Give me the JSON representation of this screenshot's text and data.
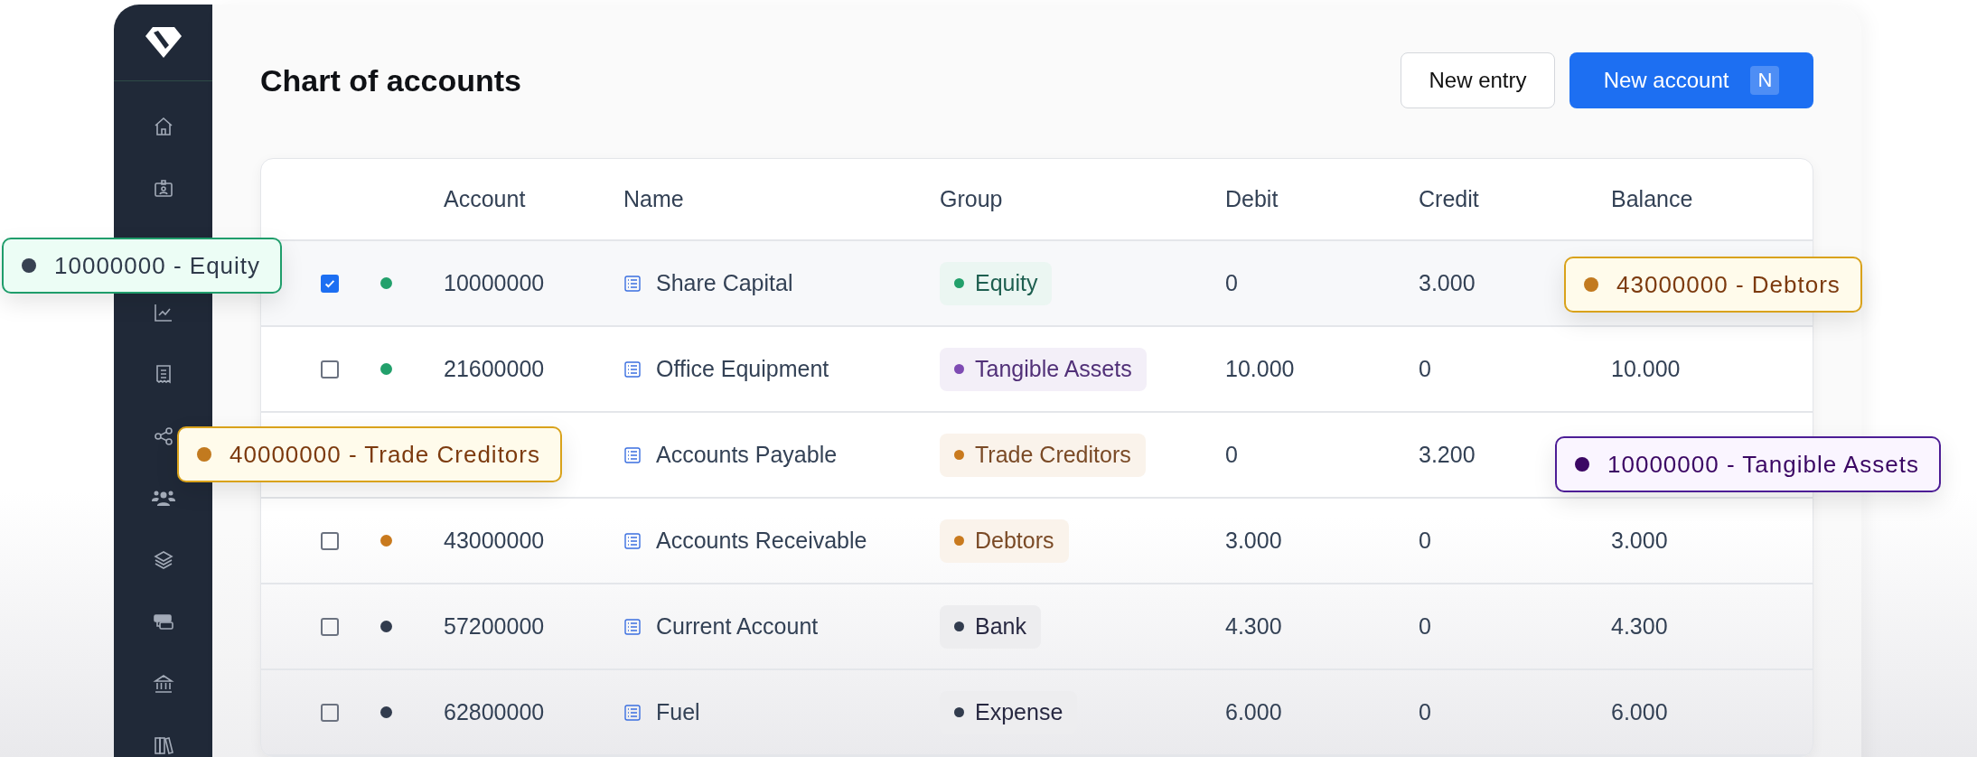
{
  "page": {
    "title": "Chart of accounts"
  },
  "actions": [
    {
      "label": "New entry",
      "kind": "secondary"
    },
    {
      "label": "New account",
      "kind": "primary",
      "shortcut": "N"
    }
  ],
  "table": {
    "columns": [
      "Account",
      "Name",
      "Group",
      "Debit",
      "Credit",
      "Balance"
    ],
    "rows": [
      {
        "checked": true,
        "color": "#22a06b",
        "account": "10000000",
        "name": "Share Capital",
        "group": {
          "label": "Equity",
          "color": "#22a06b"
        },
        "debit": "0",
        "credit": "3.000"
      },
      {
        "checked": false,
        "color": "#22a06b",
        "account": "21600000",
        "name": "Office Equipment",
        "group": {
          "label": "Tangible Assets",
          "color": "#7e4bb3"
        },
        "debit": "10.000",
        "credit": "0",
        "balance": "10.000"
      },
      {
        "name": "Accounts Payable",
        "group": {
          "label": "Trade Creditors",
          "color": "#c97a1e"
        },
        "debit": "0",
        "credit": "3.200"
      },
      {
        "checked": false,
        "color": "#c97a1e",
        "account": "43000000",
        "name": "Accounts Receivable",
        "group": {
          "label": "Debtors",
          "color": "#c97a1e"
        },
        "debit": "3.000",
        "credit": "0",
        "balance": "3.000"
      },
      {
        "checked": false,
        "color": "#323c4e",
        "account": "57200000",
        "name": "Current Account",
        "group": {
          "label": "Bank",
          "color": "#323c4e"
        },
        "debit": "4.300",
        "credit": "0",
        "balance": "4.300"
      },
      {
        "checked": false,
        "color": "#323c4e",
        "account": "62800000",
        "name": "Fuel",
        "group": {
          "label": "Expense",
          "color": "#323c4e"
        },
        "debit": "6.000",
        "credit": "0",
        "balance": "6.000"
      }
    ]
  },
  "chips": [
    {
      "label": "10000000 - Equity",
      "kind": "equity"
    },
    {
      "label": "40000000 - Trade Creditors",
      "kind": "creditors"
    },
    {
      "label": "43000000 - Debtors",
      "kind": "creditors"
    },
    {
      "label": "10000000 - Tangible Assets",
      "kind": "assets"
    }
  ]
}
